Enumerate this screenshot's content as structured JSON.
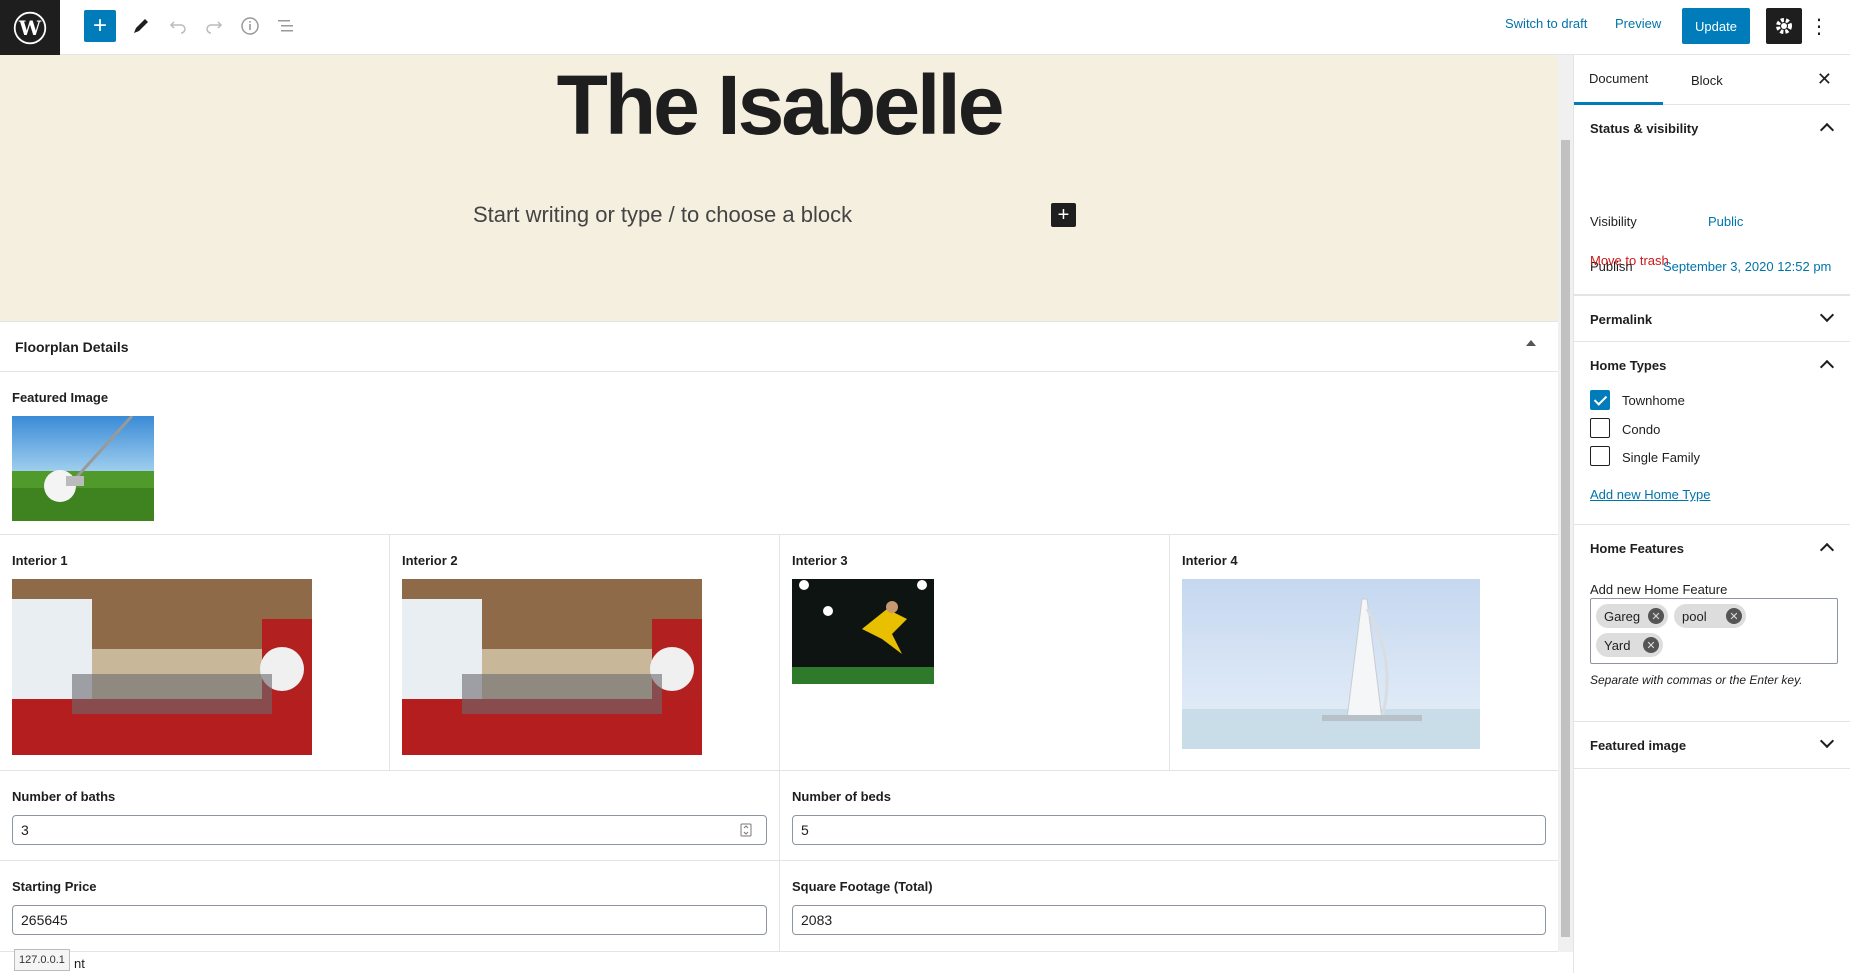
{
  "toolbar": {
    "switch_to_draft": "Switch to draft",
    "preview": "Preview",
    "update": "Update"
  },
  "post": {
    "title": "The Isabelle",
    "block_placeholder": "Start writing or type / to choose a block"
  },
  "metabox": {
    "title": "Floorplan Details",
    "featured_image_label": "Featured Image",
    "interiors": [
      {
        "label": "Interior 1"
      },
      {
        "label": "Interior 2"
      },
      {
        "label": "Interior 3"
      },
      {
        "label": "Interior 4"
      }
    ],
    "fields": {
      "baths_label": "Number of baths",
      "baths_value": "3",
      "beds_label": "Number of beds",
      "beds_value": "5",
      "price_label": "Starting Price",
      "price_value": "265645",
      "sqft_label": "Square Footage (Total)",
      "sqft_value": "2083"
    }
  },
  "sidebar": {
    "tabs": [
      "Document",
      "Block"
    ],
    "status_visibility": {
      "title": "Status & visibility",
      "visibility_label": "Visibility",
      "visibility_value": "Public",
      "publish_label": "Publish",
      "publish_value": "September 3, 2020 12:52 pm",
      "trash": "Move to trash"
    },
    "permalink": "Permalink",
    "home_types": {
      "title": "Home Types",
      "options": [
        {
          "label": "Townhome",
          "checked": true
        },
        {
          "label": "Condo",
          "checked": false
        },
        {
          "label": "Single Family",
          "checked": false
        }
      ],
      "add_new": "Add new Home Type"
    },
    "home_features": {
      "title": "Home Features",
      "add_label": "Add new Home Feature",
      "tokens": [
        "Gareg",
        "pool",
        "Yard"
      ],
      "help": "Separate with commas or the Enter key."
    },
    "featured_image": "Featured image"
  },
  "statusbar": {
    "tooltip": "127.0.0.1",
    "text": "nt"
  },
  "colors": {
    "accent": "#007cba",
    "hero_bg": "#f5efe0",
    "danger": "#cc1818"
  }
}
